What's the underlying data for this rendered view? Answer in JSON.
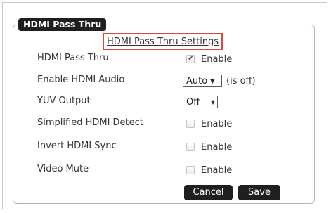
{
  "group": {
    "legend": "HDMI Pass Thru",
    "settings_link": "HDMI Pass Thru Settings"
  },
  "rows": [
    {
      "label": "HDMI Pass Thru",
      "control": "checkbox",
      "checked": true,
      "option_label": "Enable"
    },
    {
      "label": "Enable HDMI Audio",
      "control": "select",
      "value": "Auto",
      "note": "(is off)"
    },
    {
      "label": "YUV Output",
      "control": "select",
      "value": "Off"
    },
    {
      "label": "Simplified HDMI Detect",
      "control": "checkbox",
      "checked": false,
      "option_label": "Enable"
    },
    {
      "label": "Invert HDMI Sync",
      "control": "checkbox",
      "checked": false,
      "option_label": "Enable"
    },
    {
      "label": "Video Mute",
      "control": "checkbox",
      "checked": false,
      "option_label": "Enable"
    }
  ],
  "actions": {
    "cancel_label": "Cancel",
    "save_label": "Save"
  }
}
